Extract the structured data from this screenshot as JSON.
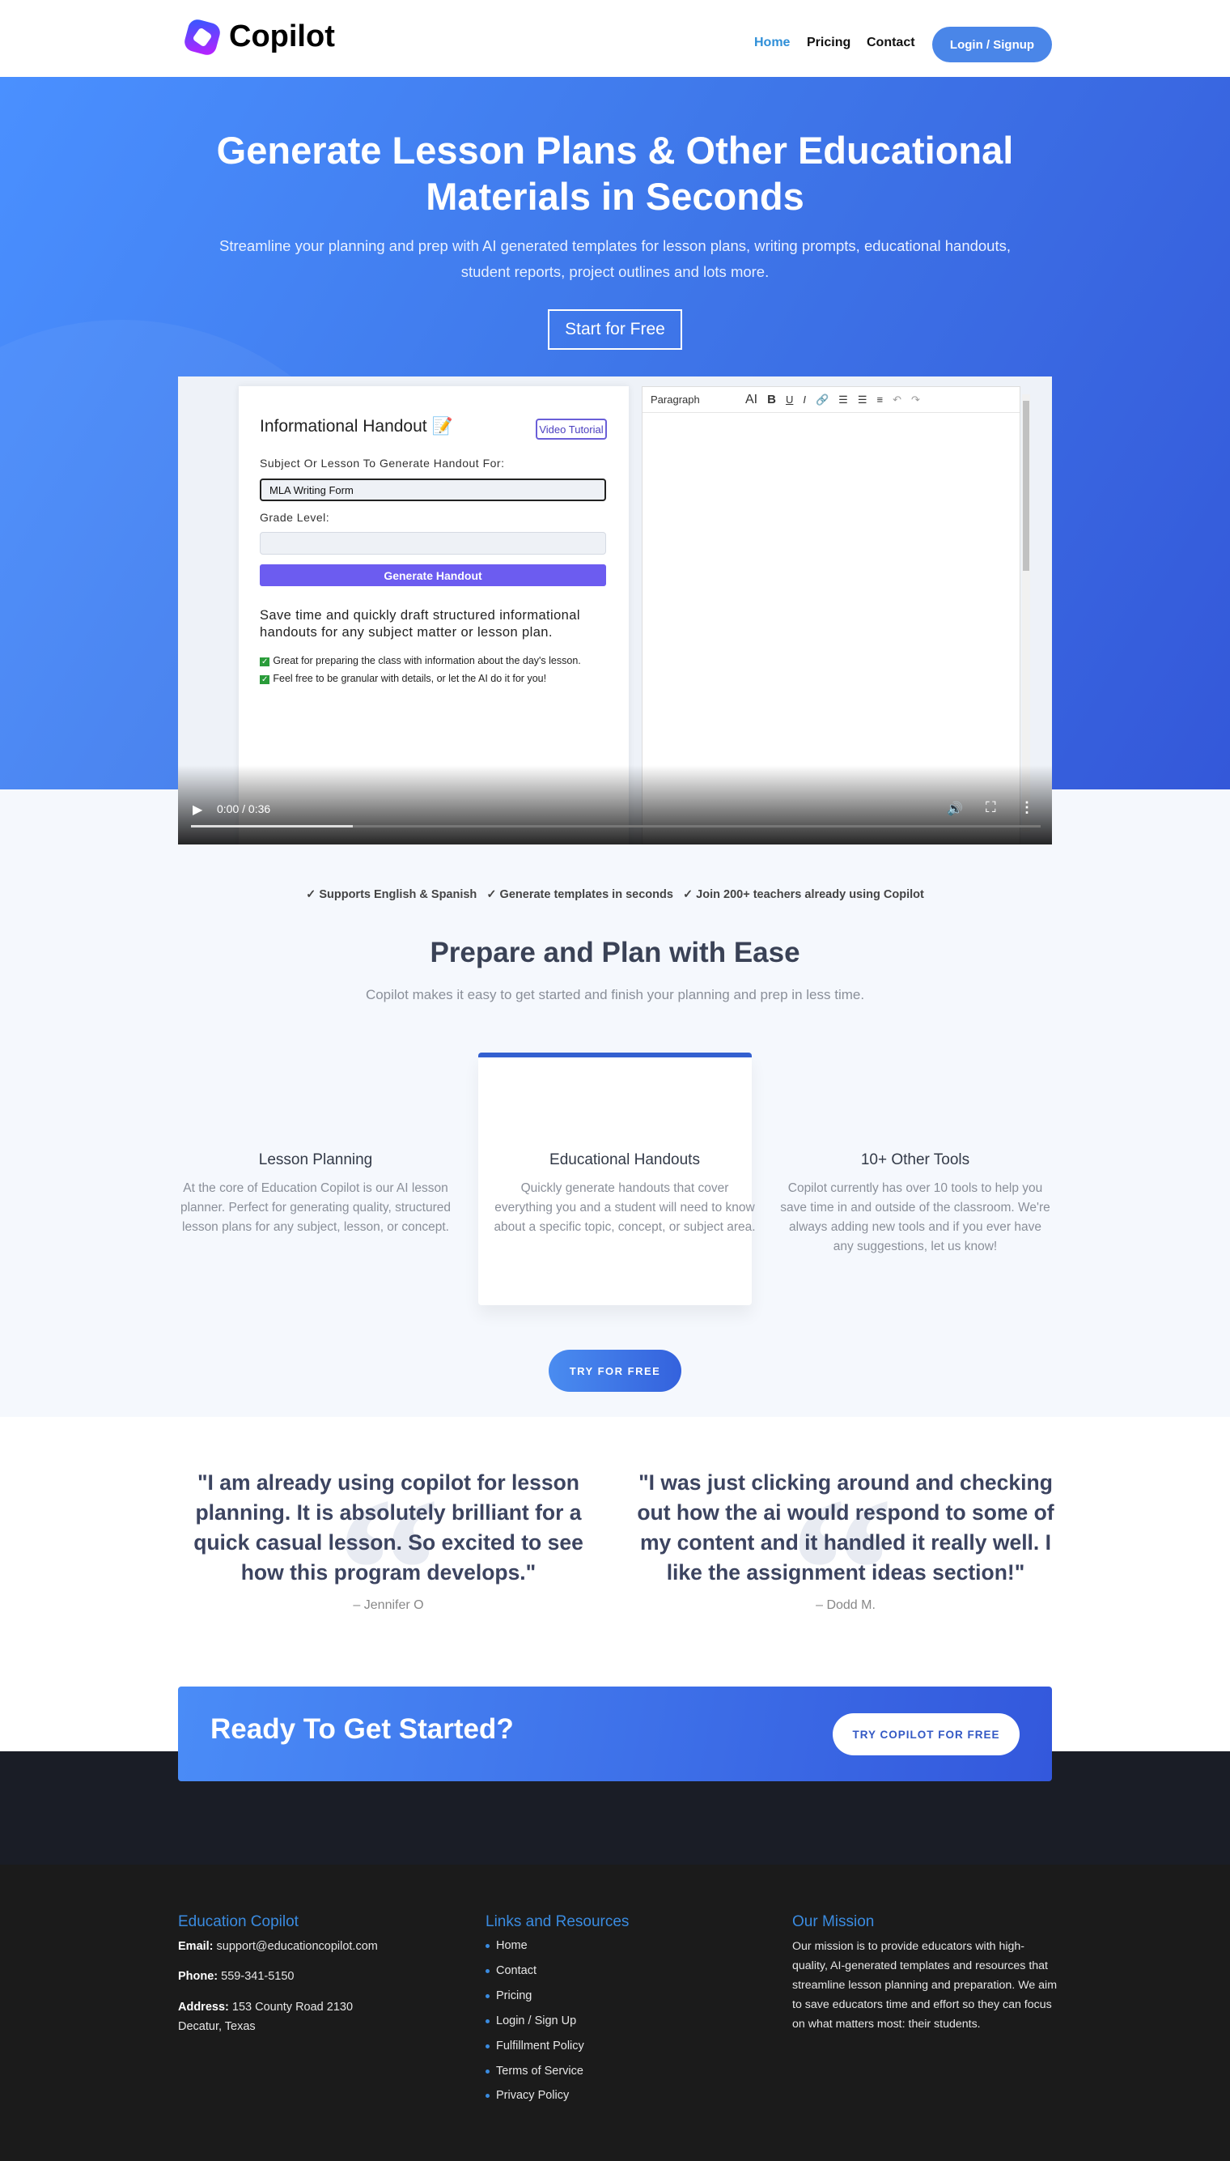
{
  "nav": {
    "brand": "Copilot",
    "links": [
      "Home",
      "Pricing",
      "Contact"
    ],
    "login": "Login / Signup",
    "active_color": "#2f8fd8"
  },
  "hero": {
    "title": "Generate Lesson Plans & Other Educational Materials in Seconds",
    "subtitle": "Streamline your planning and prep with AI generated templates for lesson plans, writing prompts, educational handouts, student reports, project outlines and lots more.",
    "cta": "Start for Free"
  },
  "video": {
    "app_title": "Informational Handout 📝",
    "tutorial": "Video Tutorial",
    "subject_label": "Subject Or Lesson To Generate Handout For:",
    "subject_value": "MLA Writing Form",
    "grade_label": "Grade Level:",
    "grade_value": "",
    "generate": "Generate Handout",
    "description": "Save time and quickly draft structured informational handouts for any subject matter or lesson plan.",
    "bullets": [
      "Great for preparing the class with information about the day's lesson.",
      "Feel free to be granular with details, or let the AI do it for you!"
    ],
    "editor": {
      "style": "Paragraph",
      "ai": "AI"
    },
    "time": "0:00 / 0:36",
    "progress_percent": 19
  },
  "features_line": "✓ Supports English & Spanish   ✓ Generate templates in seconds   ✓ Join 200+ teachers already using Copilot",
  "section": {
    "title": "Prepare and Plan with Ease",
    "subtitle": "Copilot makes it easy to get started and finish your planning and prep in less time.",
    "cards": [
      {
        "title": "Lesson Planning",
        "text": "At the core of Education Copilot is our AI lesson planner. Perfect for generating quality, structured lesson plans for any subject, lesson, or concept."
      },
      {
        "title": "Educational Handouts",
        "text": "Quickly generate handouts that cover everything you and a student will need to know about a specific topic, concept, or subject area."
      },
      {
        "title": "10+ Other Tools",
        "text": "Copilot currently has over 10 tools to help you save time in and outside of the classroom. We're always adding new tools and if you ever have any suggestions, let us know!"
      }
    ],
    "cta": "TRY FOR FREE"
  },
  "testimonials": [
    {
      "quote": "\"I am already using copilot for lesson planning. It is absolutely brilliant for a quick casual lesson. So excited to see how this program develops.\"",
      "author": "– Jennifer O"
    },
    {
      "quote": "\"I was just clicking around and checking out how the ai would respond to some of my content and it handled it really well. I like the assignment ideas section!\"",
      "author": "– Dodd M."
    }
  ],
  "cta": {
    "title": "Ready To Get Started?",
    "button": "TRY COPILOT FOR FREE"
  },
  "footer": {
    "col1": {
      "title": "Education Copilot",
      "email_label": "Email:",
      "email": "support@educationcopilot.com",
      "phone_label": "Phone:",
      "phone": "559-341-5150",
      "address_label": "Address:",
      "address1": "153 County Road 2130",
      "address2": "Decatur, Texas"
    },
    "col2": {
      "title": "Links and Resources",
      "links": [
        "Home",
        "Contact",
        "Pricing",
        "Login / Sign Up",
        "Fulfillment Policy",
        "Terms of Service",
        "Privacy Policy"
      ]
    },
    "col3": {
      "title": "Our Mission",
      "text": "Our mission is to provide educators with high-quality, AI-generated templates and resources that streamline lesson planning and preparation. We aim to save educators time and effort so they can focus on what matters most: their students."
    }
  }
}
